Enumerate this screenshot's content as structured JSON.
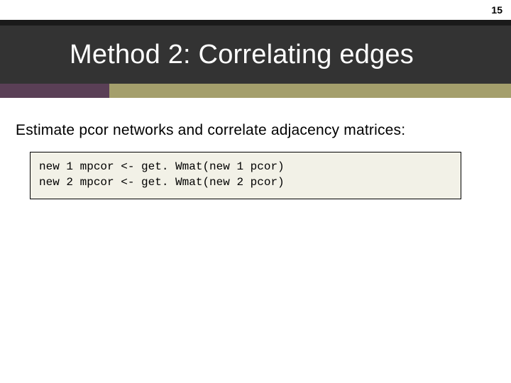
{
  "page_number": "15",
  "title": "Method 2: Correlating edges",
  "body": "Estimate pcor networks and correlate adjacency matrices:",
  "code": "new 1 mpcor <- get. Wmat(new 1 pcor)\nnew 2 mpcor <- get. Wmat(new 2 pcor)",
  "colors": {
    "header_bg": "#333333",
    "accent_left": "#5a3f56",
    "accent_right": "#a49f6c",
    "code_bg": "#f2f1e7"
  }
}
